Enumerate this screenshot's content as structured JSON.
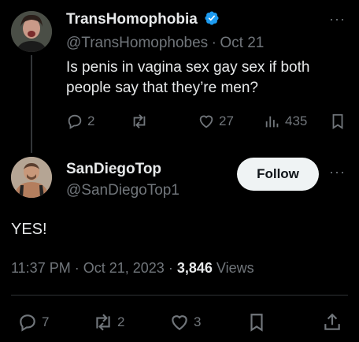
{
  "parent_tweet": {
    "display_name": "TransHomophobia",
    "handle": "@TransHomophobes",
    "separator": "·",
    "date": "Oct 21",
    "text_line1": "Is penis in vagina sex gay sex if both",
    "text_line2": "people say that they’re men?",
    "replies": "2",
    "retweets": "",
    "likes": "27",
    "views": "435",
    "verified": true
  },
  "main_tweet": {
    "display_name": "SanDiegoTop",
    "handle": "@SanDiegoTop1",
    "follow_label": "Follow",
    "text": "YES!",
    "time": "11:37 PM",
    "separator1": "·",
    "date": "Oct 21, 2023",
    "separator2": "·",
    "views_count": "3,846",
    "views_label": "Views",
    "replies": "7",
    "retweets": "2",
    "likes": "3"
  },
  "colors": {
    "background": "#000000",
    "primary_text": "#e7e9ea",
    "secondary_text": "#71767b",
    "verified_blue": "#1d9bf0",
    "follow_bg": "#eff3f4"
  }
}
